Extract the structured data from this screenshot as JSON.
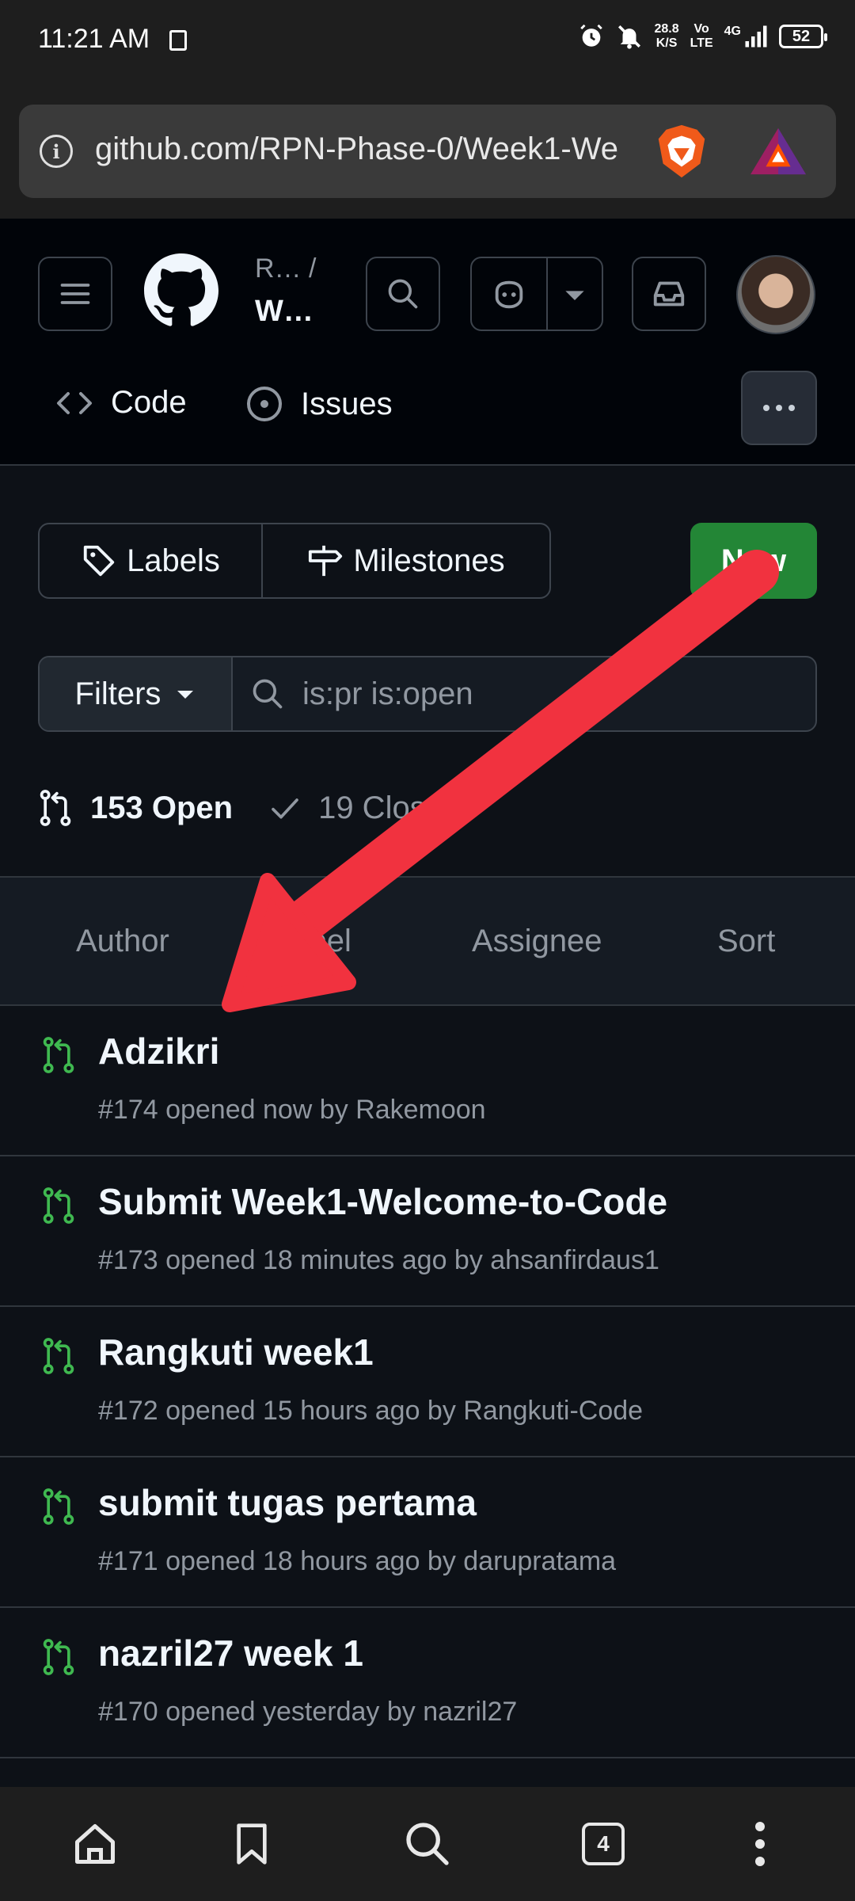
{
  "status_bar": {
    "time": "11:21 AM",
    "net_speed_value": "28.8",
    "net_speed_unit": "K/S",
    "volte_top": "Vo",
    "volte_bottom": "LTE",
    "network": "4G",
    "battery": "52",
    "icons": [
      "sim-icon",
      "alarm-icon",
      "mute-icon",
      "signal-icon",
      "battery-icon"
    ]
  },
  "browser": {
    "url": "github.com/RPN-Phase-0/Week1-We",
    "icons": [
      "info-icon",
      "brave-shield-icon",
      "bat-rewards-icon"
    ]
  },
  "header": {
    "repo_owner": "R…  /",
    "repo_name": "W…",
    "nav": {
      "code_label": "Code",
      "issues_label": "Issues"
    },
    "icons": [
      "hamburger-icon",
      "github-logo-icon",
      "search-icon",
      "copilot-icon",
      "chevron-down-icon",
      "inbox-icon",
      "more-icon"
    ]
  },
  "toolbar": {
    "labels_label": "Labels",
    "milestones_label": "Milestones",
    "new_label": "New"
  },
  "filter": {
    "button_label": "Filters",
    "query": "is:pr is:open"
  },
  "counts": {
    "open_label": "153 Open",
    "closed_label": "19 Closed"
  },
  "sort_bar": {
    "author": "Author",
    "label": "Label",
    "assignee": "Assignee",
    "sort": "Sort"
  },
  "pull_requests": [
    {
      "title": "Adzikri",
      "meta": "#174 opened now by Rakemoon"
    },
    {
      "title": "Submit Week1-Welcome-to-Code",
      "meta": "#173 opened 18 minutes ago by ahsanfirdaus1"
    },
    {
      "title": "Rangkuti week1",
      "meta": "#172 opened 15 hours ago by Rangkuti-Code"
    },
    {
      "title": "submit tugas pertama",
      "meta": "#171 opened 18 hours ago by darupratama"
    },
    {
      "title": "nazril27 week 1",
      "meta": "#170 opened yesterday by nazril27"
    }
  ],
  "bottom_nav": {
    "tab_count": "4",
    "icons": [
      "home-icon",
      "bookmark-icon",
      "search-icon",
      "tabs-icon",
      "more-vertical-icon"
    ]
  },
  "colors": {
    "background": "#0d1117",
    "header_bg": "#010409",
    "new_button": "#238636",
    "pr_open_icon": "#3fb950",
    "annotation_arrow": "#f1323f"
  }
}
